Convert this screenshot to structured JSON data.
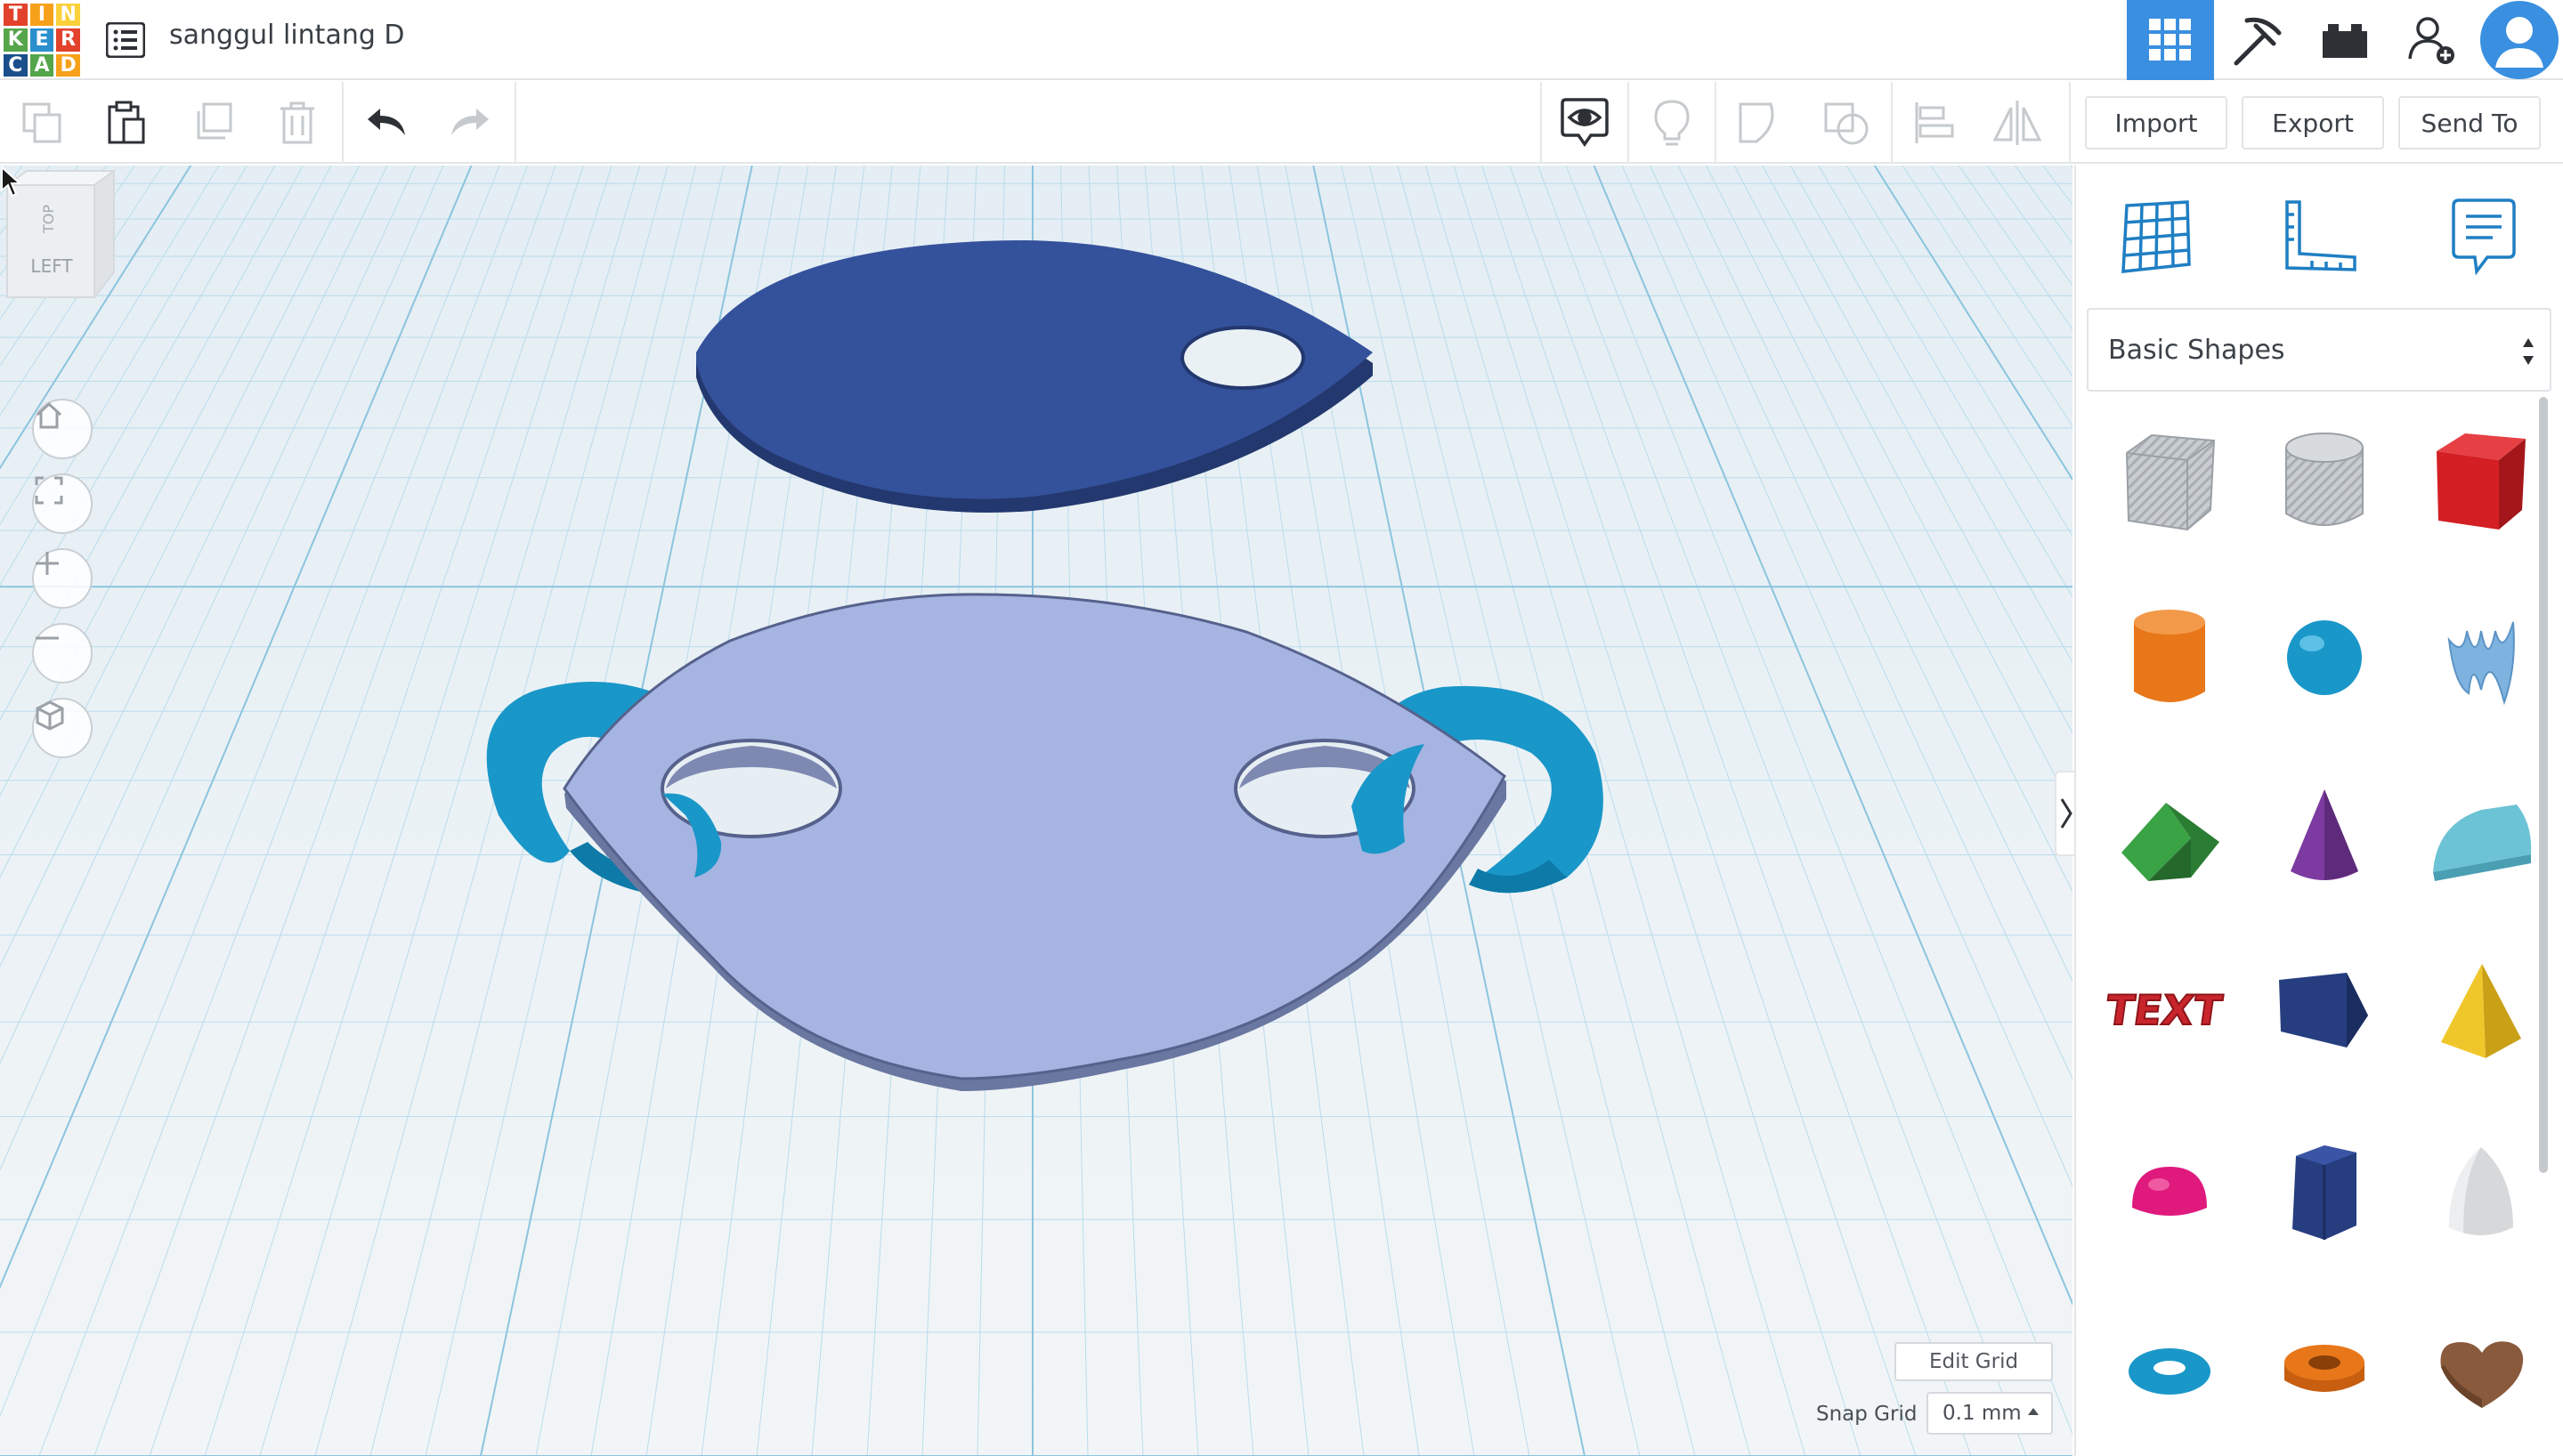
{
  "app": {
    "logo_letters": [
      "T",
      "I",
      "N",
      "K",
      "E",
      "R",
      "C",
      "A",
      "D"
    ],
    "logo_colors": [
      "#e2412b",
      "#f7a11a",
      "#fbd03b",
      "#55a54a",
      "#2b8fce",
      "#e2412b",
      "#1a4f8c",
      "#55a54a",
      "#f7a11a"
    ],
    "design_title": "sanggul lintang D",
    "accent": "#3a8fe0"
  },
  "topbar": {
    "icons": [
      "3d-design-grid-icon",
      "codeblocks-pickaxe-icon",
      "bricks-icon",
      "add-user-icon",
      "user-avatar-icon"
    ]
  },
  "toolbar": {
    "tools": [
      "copy-icon",
      "paste-icon",
      "duplicate-icon",
      "delete-icon",
      "undo-icon",
      "redo-icon",
      "show-all-icon",
      "lightbulb-icon",
      "group-icon",
      "ungroup-icon",
      "align-icon",
      "mirror-icon"
    ],
    "import_label": "Import",
    "export_label": "Export",
    "send_to_label": "Send To"
  },
  "viewcube": {
    "top_label": "TOP",
    "left_label": "LEFT"
  },
  "nav_buttons": [
    "home-view-icon",
    "fit-view-icon",
    "zoom-in-icon",
    "zoom-out-icon",
    "perspective-icon"
  ],
  "workplane": {
    "edit_grid_label": "Edit Grid",
    "snap_grid_label": "Snap Grid",
    "snap_grid_value": "0.1 mm",
    "objects": [
      {
        "name": "leaf-plate-dark",
        "color": "#34519b"
      },
      {
        "name": "round-plate-light",
        "color": "#a6b4e2"
      },
      {
        "name": "torus-ring-left",
        "color": "#1a97c9"
      },
      {
        "name": "torus-ring-right",
        "color": "#1a97c9"
      }
    ]
  },
  "panel": {
    "tools": [
      "workplane-icon",
      "ruler-icon",
      "notes-icon"
    ],
    "library_select": "Basic Shapes",
    "shapes": [
      {
        "name": "box-hole",
        "color": "#b9bec4"
      },
      {
        "name": "cylinder-hole",
        "color": "#c4c8cc"
      },
      {
        "name": "box",
        "color": "#d41f24"
      },
      {
        "name": "cylinder",
        "color": "#e8771a"
      },
      {
        "name": "sphere",
        "color": "#1a97c9"
      },
      {
        "name": "scribble",
        "color": "#7eb3e0"
      },
      {
        "name": "roof",
        "color": "#3aa345"
      },
      {
        "name": "cone",
        "color": "#7d3aa0"
      },
      {
        "name": "round-roof",
        "color": "#6cc3d5"
      },
      {
        "name": "text",
        "color": "#c9252c"
      },
      {
        "name": "wedge",
        "color": "#263d80"
      },
      {
        "name": "pyramid",
        "color": "#f0c72b"
      },
      {
        "name": "half-sphere",
        "color": "#e0197d"
      },
      {
        "name": "polygon",
        "color": "#263d80"
      },
      {
        "name": "paraboloid",
        "color": "#d6d8da"
      },
      {
        "name": "torus",
        "color": "#1a97c9"
      },
      {
        "name": "tube",
        "color": "#e8771a"
      },
      {
        "name": "heart",
        "color": "#8a5a3c"
      }
    ],
    "text_shape_label": "TEXT"
  }
}
